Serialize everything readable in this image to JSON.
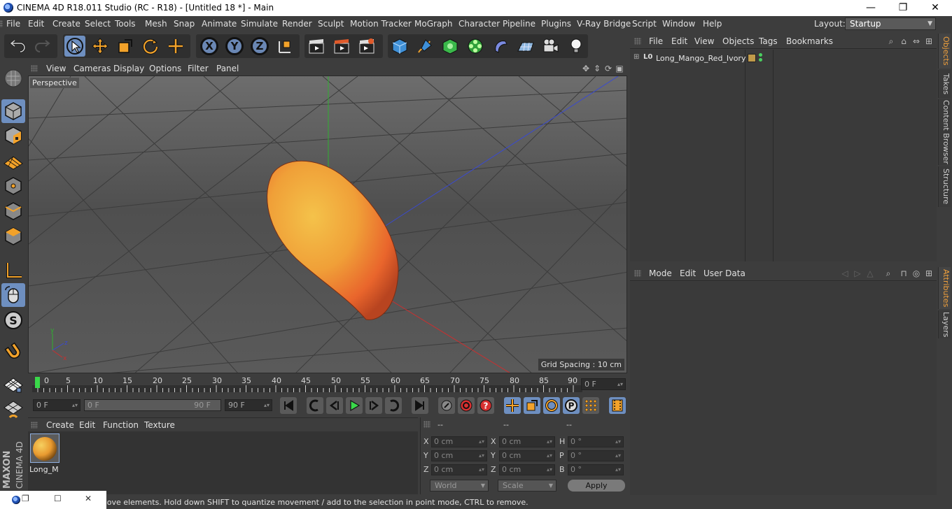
{
  "window": {
    "title": "CINEMA 4D R18.011 Studio (RC - R18) - [Untitled 18 *] - Main",
    "minimize": "—",
    "maximize": "❐",
    "close": "✕"
  },
  "menubar": {
    "items": [
      "File",
      "Edit",
      "Create",
      "Select",
      "Tools",
      "Mesh",
      "Snap",
      "Animate",
      "Simulate",
      "Render",
      "Sculpt",
      "Motion Tracker",
      "MoGraph",
      "Character",
      "Pipeline",
      "Plugins",
      "V-Ray Bridge",
      "Script",
      "Window",
      "Help"
    ],
    "layout_label": "Layout:",
    "layout_value": "Startup"
  },
  "toolbar": {
    "axes": [
      "X",
      "Y",
      "Z"
    ]
  },
  "viewport": {
    "menu": [
      "View",
      "Cameras",
      "Display",
      "Options",
      "Filter",
      "Panel"
    ],
    "camera_label": "Perspective",
    "grid_spacing": "Grid Spacing : 10 cm"
  },
  "timeline": {
    "ticks": [
      "0",
      "5",
      "10",
      "15",
      "20",
      "25",
      "30",
      "35",
      "40",
      "45",
      "50",
      "55",
      "60",
      "65",
      "70",
      "75",
      "80",
      "85",
      "90"
    ],
    "current_frame": "0 F",
    "start_field": "0 F",
    "range_start": "0 F",
    "range_end": "90 F",
    "end_field": "90 F"
  },
  "material_manager": {
    "menu": [
      "Create",
      "Edit",
      "Function",
      "Texture"
    ],
    "material_name": "Long_M"
  },
  "coordinates": {
    "headers": [
      "--",
      "--",
      "--"
    ],
    "rows": [
      {
        "l1": "X",
        "v1": "0 cm",
        "l2": "X",
        "v2": "0 cm",
        "l3": "H",
        "v3": "0 °"
      },
      {
        "l1": "Y",
        "v1": "0 cm",
        "l2": "Y",
        "v2": "0 cm",
        "l3": "P",
        "v3": "0 °"
      },
      {
        "l1": "Z",
        "v1": "0 cm",
        "l2": "Z",
        "v2": "0 cm",
        "l3": "B",
        "v3": "0 °"
      }
    ],
    "space_dropdown": "World",
    "mode_dropdown": "Scale",
    "apply_label": "Apply"
  },
  "object_manager": {
    "menu": [
      "File",
      "Edit",
      "View",
      "Objects",
      "Tags",
      "Bookmarks"
    ],
    "objects": [
      {
        "name": "Long_Mango_Red_Ivory"
      }
    ]
  },
  "attribute_manager": {
    "menu": [
      "Mode",
      "Edit",
      "User Data"
    ]
  },
  "side_tabs_top": [
    "Objects",
    "Takes",
    "Content Browser",
    "Structure"
  ],
  "side_tabs_bottom": [
    "Attributes",
    "Layers"
  ],
  "status": {
    "text": "move elements. Hold down SHIFT to quantize movement / add to the selection in point mode, CTRL to remove."
  },
  "logo": {
    "text_1": "MAXON",
    "text_2": "CINEMA 4D"
  },
  "colors": {
    "accent": "#f0a03c",
    "selection": "#6e8fc0",
    "axis_x": "#c83030",
    "axis_y": "#30b030",
    "axis_z": "#3a4ad0"
  }
}
